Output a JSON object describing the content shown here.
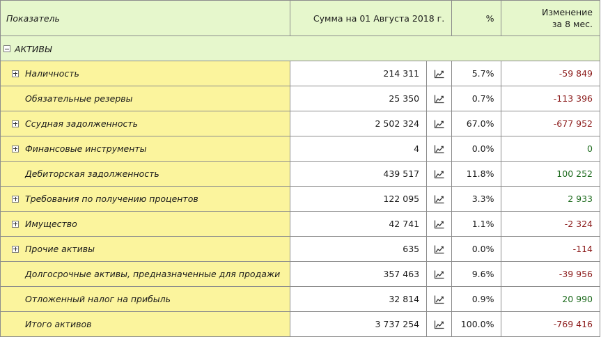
{
  "header": {
    "indicator": "Показатель",
    "sum": "Сумма на 01 Августа 2018 г.",
    "pct": "%",
    "change_line1": "Изменение",
    "change_line2": "за 8 мес."
  },
  "section": {
    "label": "АКТИВЫ",
    "expander": "minus"
  },
  "chart_icon": "line-chart-icon",
  "colors": {
    "negative": "#8b1a1a",
    "positive": "#1e6b1e",
    "name_bg": "#fbf49d",
    "header_bg": "#e6f7cc"
  },
  "rows": [
    {
      "name": "Наличность",
      "expandable": true,
      "sum": "214 311",
      "pct": "5.7%",
      "change": "-59 849",
      "sign": "neg"
    },
    {
      "name": "Обязательные резервы",
      "expandable": false,
      "sum": "25 350",
      "pct": "0.7%",
      "change": "-113 396",
      "sign": "neg"
    },
    {
      "name": "Ссудная задолженность",
      "expandable": true,
      "sum": "2 502 324",
      "pct": "67.0%",
      "change": "-677 952",
      "sign": "neg"
    },
    {
      "name": "Финансовые инструменты",
      "expandable": true,
      "sum": "4",
      "pct": "0.0%",
      "change": "0",
      "sign": "pos"
    },
    {
      "name": "Дебиторская задолженность",
      "expandable": false,
      "sum": "439 517",
      "pct": "11.8%",
      "change": "100 252",
      "sign": "pos"
    },
    {
      "name": "Требования по получению процентов",
      "expandable": true,
      "sum": "122 095",
      "pct": "3.3%",
      "change": "2 933",
      "sign": "pos"
    },
    {
      "name": "Имущество",
      "expandable": true,
      "sum": "42 741",
      "pct": "1.1%",
      "change": "-2 324",
      "sign": "neg"
    },
    {
      "name": "Прочие активы",
      "expandable": true,
      "sum": "635",
      "pct": "0.0%",
      "change": "-114",
      "sign": "neg"
    },
    {
      "name": "Долгосрочные активы, предназначенные для продажи",
      "expandable": false,
      "sum": "357 463",
      "pct": "9.6%",
      "change": "-39 956",
      "sign": "neg"
    },
    {
      "name": "Отложенный налог на прибыль",
      "expandable": false,
      "sum": "32 814",
      "pct": "0.9%",
      "change": "20 990",
      "sign": "pos"
    },
    {
      "name": "Итого активов",
      "expandable": false,
      "sum": "3 737 254",
      "pct": "100.0%",
      "change": "-769 416",
      "sign": "neg"
    }
  ]
}
